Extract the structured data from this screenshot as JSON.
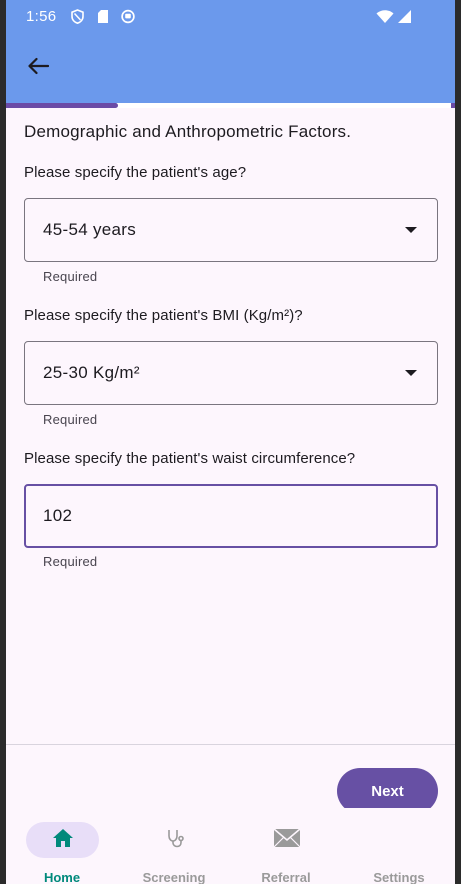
{
  "status_bar": {
    "time": "1:56",
    "icons": [
      "shield-icon",
      "sim-card-icon",
      "circle-app-icon",
      "wifi-icon",
      "signal-icon"
    ]
  },
  "app_bar": {
    "back_icon": "arrow-left-icon"
  },
  "progress": {
    "fraction": 0.25
  },
  "form": {
    "section_title": "Demographic and Anthropometric Factors.",
    "questions": [
      {
        "label": "Please specify the patient's age?",
        "value": "45-54 years",
        "type": "dropdown",
        "helper": "Required"
      },
      {
        "label": "Please specify the patient's BMI (Kg/m²)?",
        "value": "25-30 Kg/m²",
        "type": "dropdown",
        "helper": "Required"
      },
      {
        "label": "Please specify the patient's waist circumference?",
        "value": "102",
        "type": "text",
        "helper": "Required"
      }
    ]
  },
  "actions": {
    "next_label": "Next"
  },
  "bottom_nav": {
    "items": [
      {
        "label": "Home",
        "icon": "home-icon",
        "active": true
      },
      {
        "label": "Screening",
        "icon": "stethoscope-icon",
        "active": false
      },
      {
        "label": "Referral",
        "icon": "envelope-icon",
        "active": false
      },
      {
        "label": "Settings",
        "icon": "settings-icon",
        "active": false
      }
    ]
  },
  "colors": {
    "app_bar": "#6b99ec",
    "primary": "#6750a4",
    "active_nav": "#00897b",
    "background": "#fdf6fd"
  }
}
